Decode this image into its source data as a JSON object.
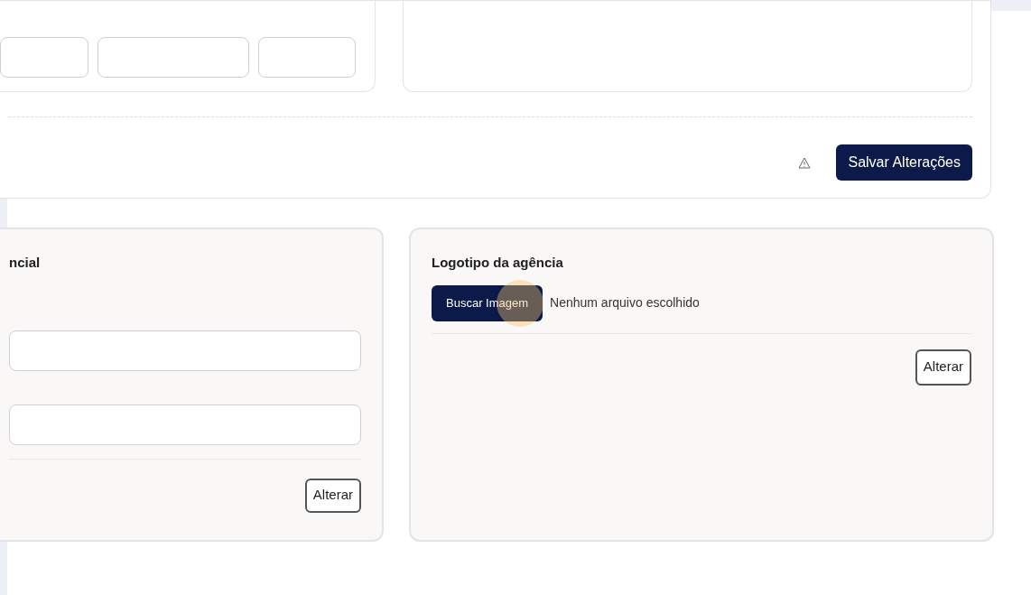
{
  "address_card": {
    "save_button": "Salvar Alterações"
  },
  "left_card": {
    "title": "ncial",
    "button": "Alterar"
  },
  "logo_card": {
    "title": "Logotipo da agência",
    "file_button": "Buscar Imagem",
    "file_status": "Nenhum arquivo escolhido",
    "button": "Alterar"
  }
}
